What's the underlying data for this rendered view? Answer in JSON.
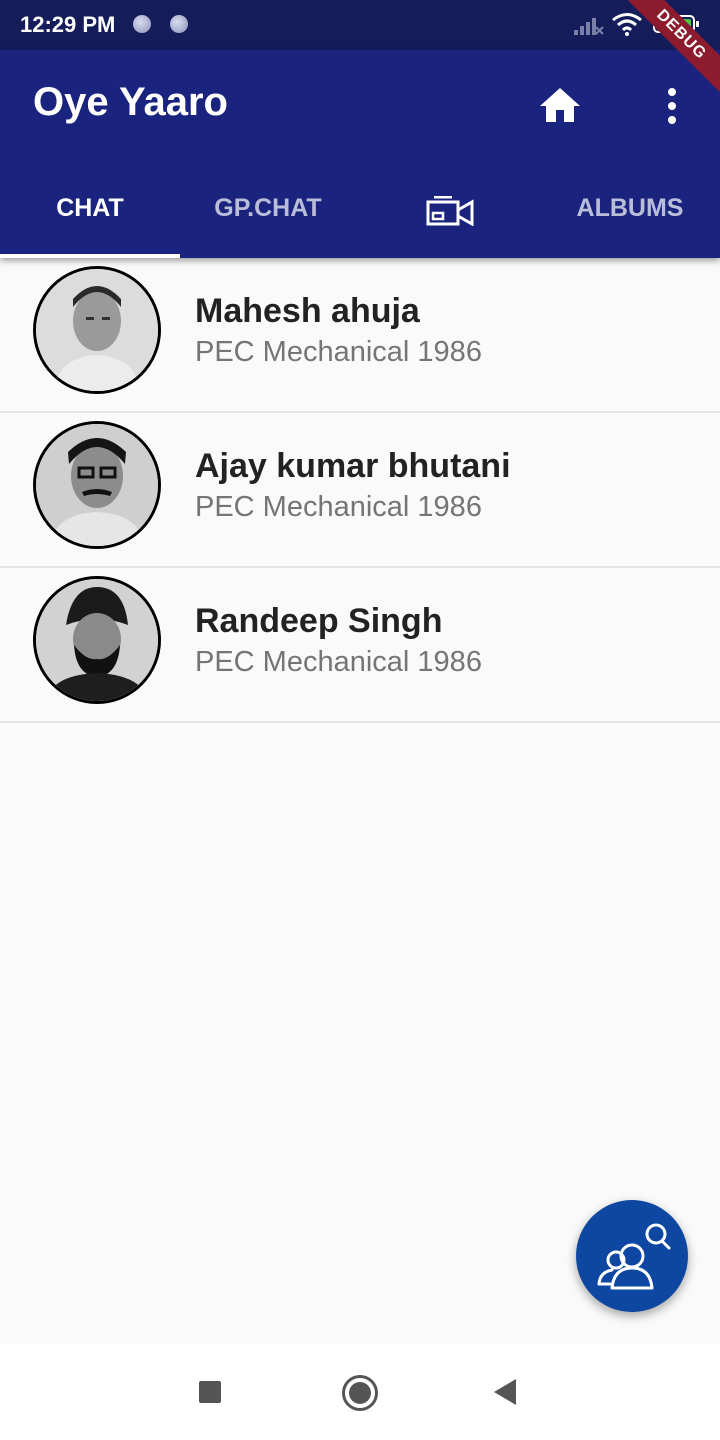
{
  "status_bar": {
    "time": "12:29 PM",
    "battery": "91"
  },
  "app_bar": {
    "title": "Oye Yaaro",
    "home_icon": "home-icon",
    "more_icon": "more-vert-icon"
  },
  "tabs": [
    {
      "label": "CHAT",
      "active": true
    },
    {
      "label": "GP.CHAT",
      "active": false
    },
    {
      "label": "",
      "icon": "video-chat-icon",
      "active": false
    },
    {
      "label": "ALBUMS",
      "active": false
    }
  ],
  "debug_banner": "DEBUG",
  "contacts": [
    {
      "name": "Mahesh ahuja",
      "subtitle": "PEC Mechanical 1986"
    },
    {
      "name": "Ajay kumar bhutani",
      "subtitle": "PEC Mechanical 1986"
    },
    {
      "name": "Randeep Singh",
      "subtitle": "PEC Mechanical 1986"
    }
  ],
  "fab": {
    "icon": "group-search-icon"
  },
  "colors": {
    "primary": "#1a237e",
    "status_bar": "#141d5a",
    "fab": "#0d47a1",
    "background": "#fafafa"
  }
}
